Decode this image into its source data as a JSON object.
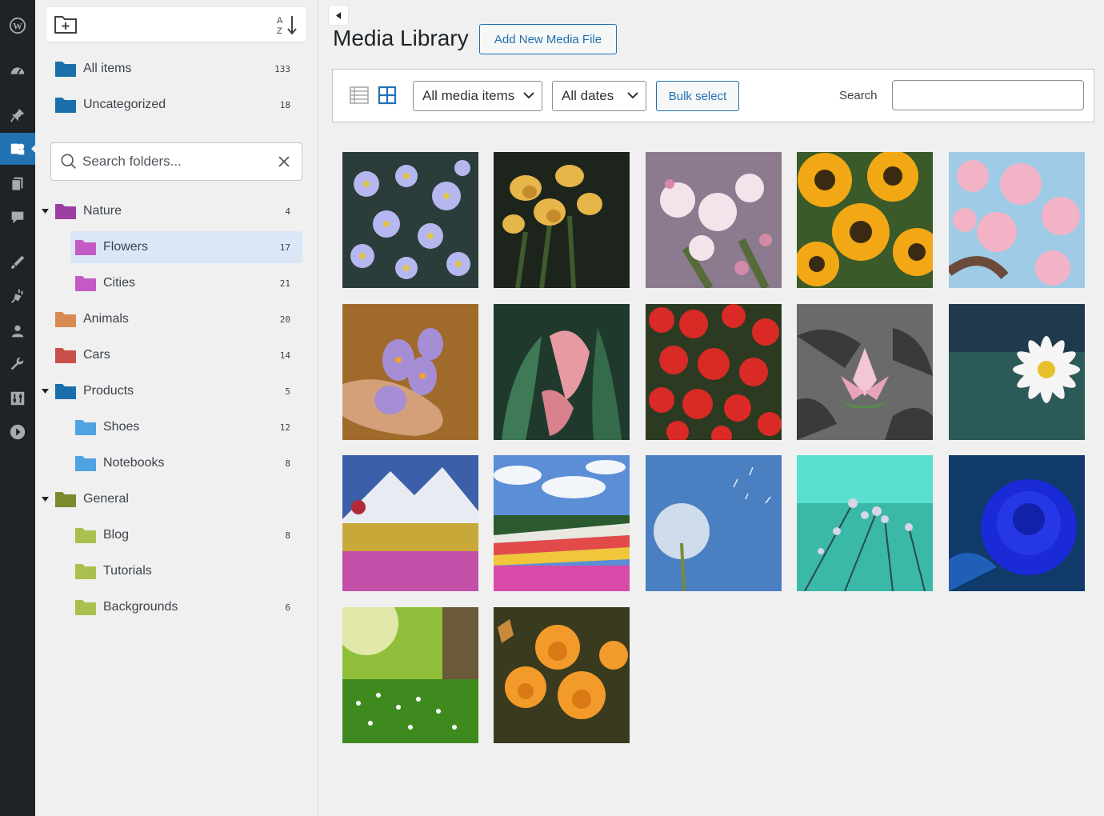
{
  "wp_menu": [
    "wordpress-logo-icon",
    "dashboard-icon",
    "posts-pin-icon",
    "media-icon",
    "pages-icon",
    "comments-icon",
    "appearance-icon",
    "plugins-icon",
    "users-icon",
    "tools-icon",
    "settings-icon",
    "play-icon"
  ],
  "folders": {
    "toolbar": {
      "new_folder_icon": "folder-plus-icon",
      "sort_icon": "sort-az-icon"
    },
    "all_items": {
      "label": "All items",
      "count": "133",
      "color": "#1a6fab"
    },
    "uncategorized": {
      "label": "Uncategorized",
      "count": "18",
      "color": "#1a6fab"
    },
    "search_placeholder": "Search folders...",
    "tree": [
      {
        "label": "Nature",
        "count": "4",
        "color": "#9b3fa3",
        "level": 0,
        "expanded": true
      },
      {
        "label": "Flowers",
        "count": "17",
        "color": "#c45bc4",
        "level": 1,
        "selected": true
      },
      {
        "label": "Cities",
        "count": "21",
        "color": "#c45bc4",
        "level": 1
      },
      {
        "label": "Animals",
        "count": "20",
        "color": "#d98a52",
        "level": 0
      },
      {
        "label": "Cars",
        "count": "14",
        "color": "#c9504a",
        "level": 0
      },
      {
        "label": "Products",
        "count": "5",
        "color": "#1a6fab",
        "level": 0,
        "expanded": true
      },
      {
        "label": "Shoes",
        "count": "12",
        "color": "#4fa3e0",
        "level": 1
      },
      {
        "label": "Notebooks",
        "count": "8",
        "color": "#4fa3e0",
        "level": 1
      },
      {
        "label": "General",
        "count": "",
        "color": "#7a8a2e",
        "level": 0,
        "expanded": true
      },
      {
        "label": "Blog",
        "count": "8",
        "color": "#a9c04f",
        "level": 1
      },
      {
        "label": "Tutorials",
        "count": "",
        "color": "#a9c04f",
        "level": 1
      },
      {
        "label": "Backgrounds",
        "count": "6",
        "color": "#a9c04f",
        "level": 1
      }
    ]
  },
  "main": {
    "title": "Media Library",
    "add_new_label": "Add New Media File",
    "filter": {
      "media_select": "All media items",
      "dates_select": "All dates",
      "bulk_label": "Bulk select",
      "search_label": "Search",
      "search_value": ""
    },
    "media": [
      {
        "name": "purple-asters"
      },
      {
        "name": "yellow-tulips"
      },
      {
        "name": "apple-blossom"
      },
      {
        "name": "sunflowers"
      },
      {
        "name": "cherry-blossom"
      },
      {
        "name": "crocus-in-hand"
      },
      {
        "name": "pink-calla-lily"
      },
      {
        "name": "red-begonias"
      },
      {
        "name": "water-lily"
      },
      {
        "name": "white-daisy"
      },
      {
        "name": "mountain-meadow"
      },
      {
        "name": "flower-field"
      },
      {
        "name": "dandelion-sky"
      },
      {
        "name": "dewy-teal-flowers"
      },
      {
        "name": "blue-rose"
      },
      {
        "name": "sunny-meadow"
      },
      {
        "name": "orange-flowers-butterfly"
      }
    ]
  }
}
